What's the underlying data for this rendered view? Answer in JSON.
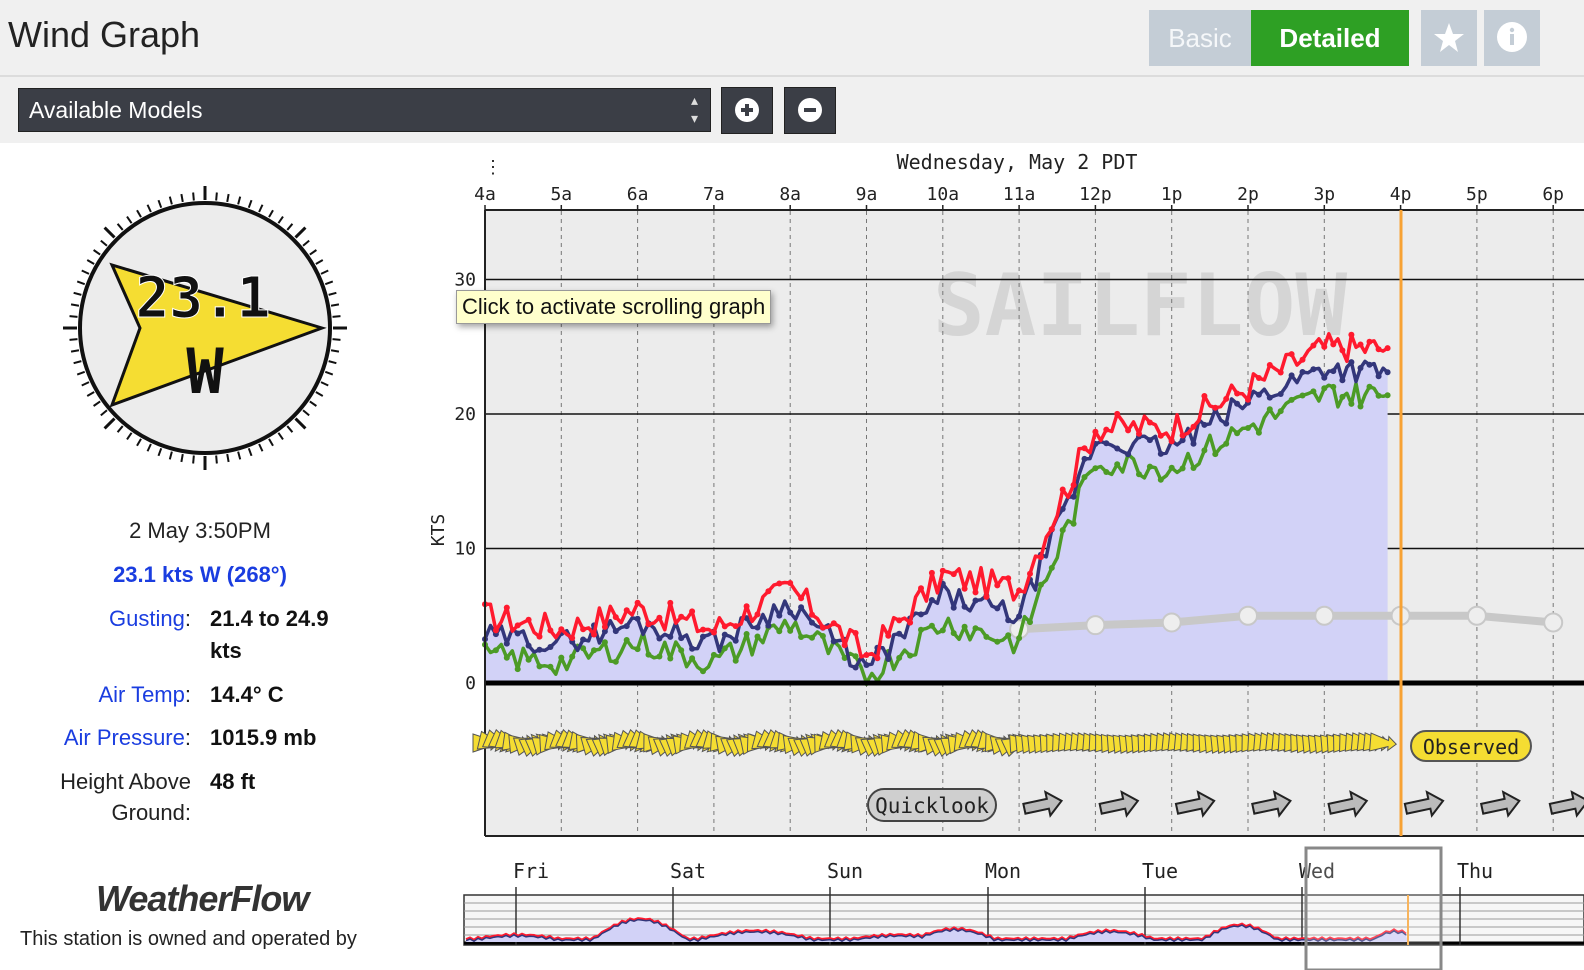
{
  "header": {
    "title": "Wind Graph",
    "basic_label": "Basic",
    "detailed_label": "Detailed",
    "star_icon": "star-icon",
    "info_icon": "info-icon"
  },
  "toolbar": {
    "models_label": "Available Models",
    "add_icon": "plus-circle-icon",
    "remove_icon": "minus-circle-icon"
  },
  "station": {
    "datetime": "2 May 3:50PM",
    "current_wind": "23.1 kts W (268°)",
    "compass_speed": "23.1",
    "compass_dir": "W",
    "gusting_label": "Gusting",
    "gusting_value_line1": "21.4 to 24.9",
    "gusting_value_line2": "kts",
    "air_temp_label": "Air Temp",
    "air_temp_value": "14.4° C",
    "air_pressure_label": "Air Pressure",
    "air_pressure_value": "1015.9 mb",
    "height_label_line1": "Height Above",
    "height_label_line2": "Ground:",
    "height_value": "48 ft",
    "brand": "WeatherFlow",
    "owned_text": "This station is owned and operated by"
  },
  "graph": {
    "date_title": "Wednesday, May 2 PDT",
    "ylabel": "KTS",
    "watermark": "SAILFLOW",
    "tooltip": "Click to activate scrolling graph",
    "observed_label": "Observed",
    "quicklook_label": "Quicklook",
    "hour_labels": [
      "4a",
      "5a",
      "6a",
      "7a",
      "8a",
      "9a",
      "10a",
      "11a",
      "12p",
      "1p",
      "2p",
      "3p",
      "4p",
      "5p",
      "6p"
    ],
    "y_ticks": [
      "30",
      "20",
      "10",
      "0"
    ],
    "colors": {
      "gust": "#ff1a2e",
      "avg": "#33367a",
      "lull": "#4c9b26",
      "fill": "#d2d2f7",
      "forecast": "#c8c8c8",
      "now_line": "#f7a234"
    }
  },
  "overview": {
    "day_labels": [
      "Fri",
      "Sat",
      "Sun",
      "Mon",
      "Tue",
      "Wed",
      "Thu"
    ]
  },
  "chart_data": {
    "type": "line",
    "title": "Wednesday, May 2 PDT",
    "ylabel": "KTS",
    "ylim": [
      0,
      35
    ],
    "x": [
      "4a",
      "5a",
      "6a",
      "7a",
      "8a",
      "9a",
      "10a",
      "11a",
      "12p",
      "1p",
      "2p",
      "3p",
      "3:50p"
    ],
    "series": [
      {
        "name": "",
        "values": [
          5,
          4,
          5.5,
          4,
          7,
          2,
          8,
          7,
          19,
          19,
          22,
          25,
          24.9
        ]
      },
      {
        "name": "",
        "values": [
          3.5,
          3,
          4.5,
          3,
          6,
          1,
          6.5,
          5,
          18,
          17.5,
          21,
          23.5,
          23.1
        ]
      },
      {
        "name": "",
        "values": [
          2,
          1.5,
          3,
          1.5,
          4.5,
          0.5,
          4.5,
          3,
          16.5,
          16,
          19,
          21.5,
          21.4
        ]
      }
    ],
    "forecast": {
      "x": [
        "11a",
        "12p",
        "1p",
        "2p",
        "3p",
        "4p",
        "5p",
        "6p"
      ],
      "values": [
        4,
        4.3,
        4.5,
        5,
        5,
        5,
        5,
        4.5
      ]
    }
  }
}
